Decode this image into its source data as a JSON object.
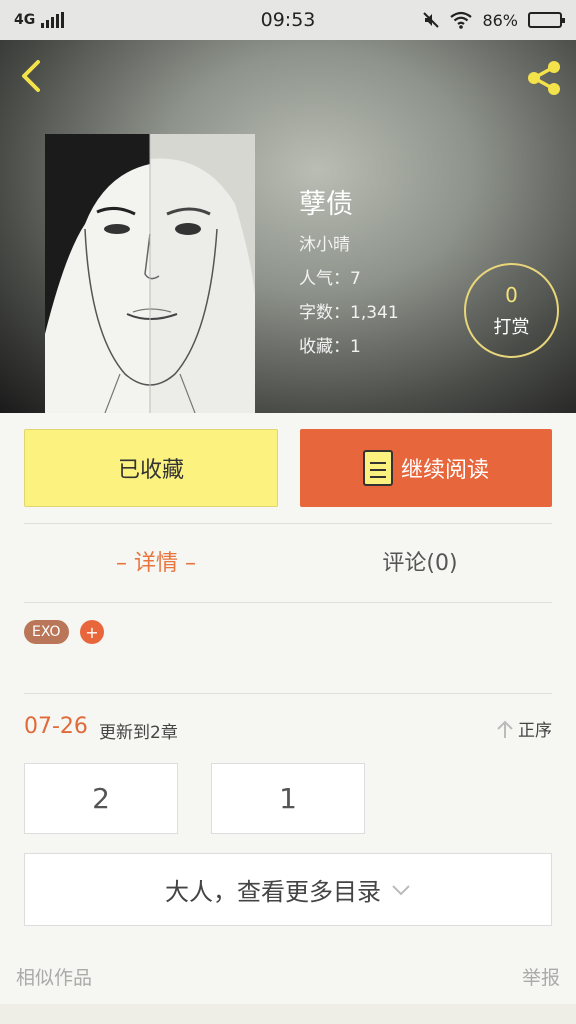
{
  "status_bar": {
    "network": "4G",
    "time": "09:53",
    "battery": "86%"
  },
  "book": {
    "title": "孽债",
    "author": "沐小晴",
    "popularity": "人气：7",
    "word_count": "字数：1,341",
    "favorites": "收藏：1"
  },
  "tip": {
    "count": "0",
    "label": "打赏"
  },
  "actions": {
    "favorited_label": "已收藏",
    "continue_label": "继续阅读"
  },
  "tabs": {
    "details": "– 详情 –",
    "comments": "评论(0)"
  },
  "tags": {
    "items": [
      "EXO"
    ],
    "add": "+"
  },
  "update": {
    "date": "07-26",
    "text": "更新到2章",
    "sort_label": "正序"
  },
  "chapters": [
    "2",
    "1"
  ],
  "more_catalog": "大人，查看更多目录",
  "footer": {
    "similar": "相似作品",
    "report": "举报"
  },
  "colors": {
    "accent": "#e8663c",
    "favorite_yellow": "#fcf27f",
    "tip_ring": "#e9d67a"
  }
}
